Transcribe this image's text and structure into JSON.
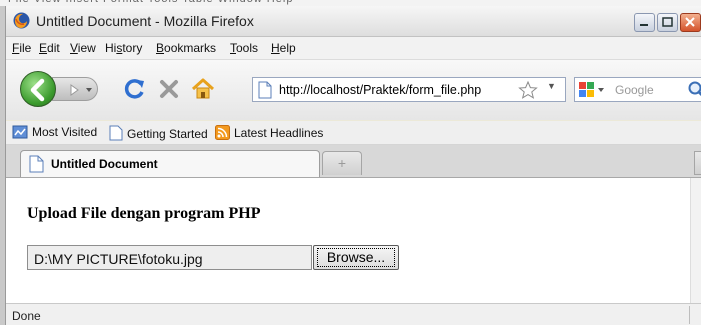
{
  "window": {
    "title": "Untitled Document - Mozilla Firefox"
  },
  "menu": [
    {
      "label": "File",
      "key": "F",
      "rest": "ile"
    },
    {
      "label": "Edit",
      "key": "E",
      "rest": "dit"
    },
    {
      "label": "View",
      "key": "V",
      "rest": "iew"
    },
    {
      "label": "History",
      "key": "s",
      "pre": "Hi",
      "rest": "tory"
    },
    {
      "label": "Bookmarks",
      "key": "B",
      "rest": "ookmarks"
    },
    {
      "label": "Tools",
      "key": "T",
      "rest": "ools"
    },
    {
      "label": "Help",
      "key": "H",
      "rest": "elp"
    }
  ],
  "navbar": {
    "url": "http://localhost/Praktek/form_file.php",
    "search_placeholder": "Google",
    "icons": [
      "back-arrow-icon",
      "forward-arrow-icon",
      "reload-icon",
      "stop-icon",
      "home-icon",
      "page-icon",
      "star-icon",
      "search-engine-icon",
      "magnifier-icon"
    ]
  },
  "bookmarks": [
    {
      "label": "Most Visited",
      "icon": "most-visited-icon"
    },
    {
      "label": "Getting Started",
      "icon": "page-icon"
    },
    {
      "label": "Latest Headlines",
      "icon": "rss-icon"
    }
  ],
  "tabs": [
    {
      "title": "Untitled Document",
      "active": true
    }
  ],
  "newtab_glyph": "+",
  "page": {
    "heading": "Upload File dengan program PHP",
    "file_value": "D:\\MY PICTURE\\fotoku.jpg",
    "browse_label": "Browse..."
  },
  "status": {
    "text": "Done"
  },
  "colors": {
    "back_button": "#3a9a2c",
    "reload": "#2f6fd0",
    "stop": "#9a9a9a",
    "home": "#e8a21d"
  }
}
